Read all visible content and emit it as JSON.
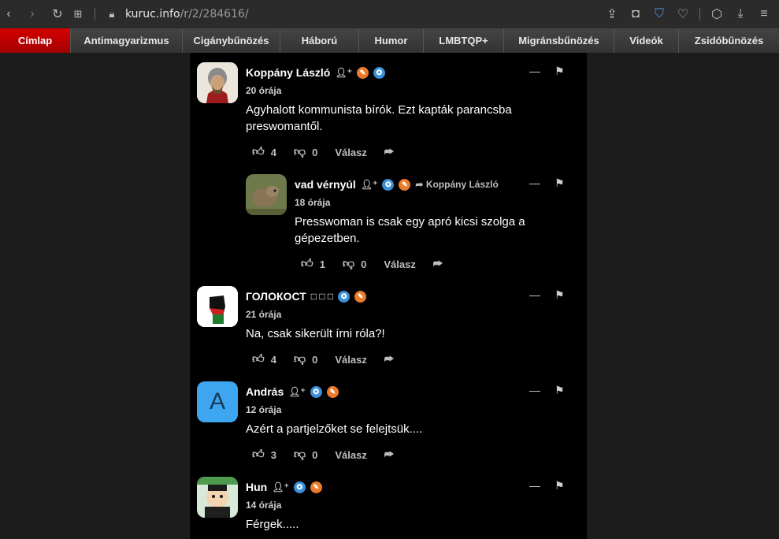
{
  "browser": {
    "url_domain": "kuruc.info",
    "url_path": "/r/2/284616/"
  },
  "nav": {
    "items": [
      {
        "label": "Címlap",
        "active": true
      },
      {
        "label": "Antimagyarizmus"
      },
      {
        "label": "Cigánybűnözés"
      },
      {
        "label": "Háború"
      },
      {
        "label": "Humor"
      },
      {
        "label": "LMBTQP+"
      },
      {
        "label": "Migránsbűnözés"
      },
      {
        "label": "Videók"
      },
      {
        "label": "Zsidóbűnözés"
      }
    ]
  },
  "comments": [
    {
      "name": "Koppány László",
      "time": "20 órája",
      "text": "Agyhalott kommunista bírók. Ezt kapták parancsba preswomantől.",
      "likes": "4",
      "dislikes": "0",
      "reply_label": "Válasz"
    },
    {
      "name": "vad vérnyúl",
      "reply_to": "Koppány László",
      "time": "18 órája",
      "text": "Presswoman is csak egy apró kicsi szolga a gépezetben.",
      "likes": "1",
      "dislikes": "0",
      "reply_label": "Válasz"
    },
    {
      "name": "ГОЛОКОСТ",
      "name_suffix": "□ □ □",
      "time": "21 órája",
      "text": "Na, csak sikerült írni róla?!",
      "likes": "4",
      "dislikes": "0",
      "reply_label": "Válasz"
    },
    {
      "name": "András",
      "avatar_letter": "A",
      "time": "12 órája",
      "text": "Azért a partjelzőket se felejtsük....",
      "likes": "3",
      "dislikes": "0",
      "reply_label": "Válasz"
    },
    {
      "name": "Hun",
      "time": "14 órája",
      "text": "Férgek....."
    }
  ]
}
